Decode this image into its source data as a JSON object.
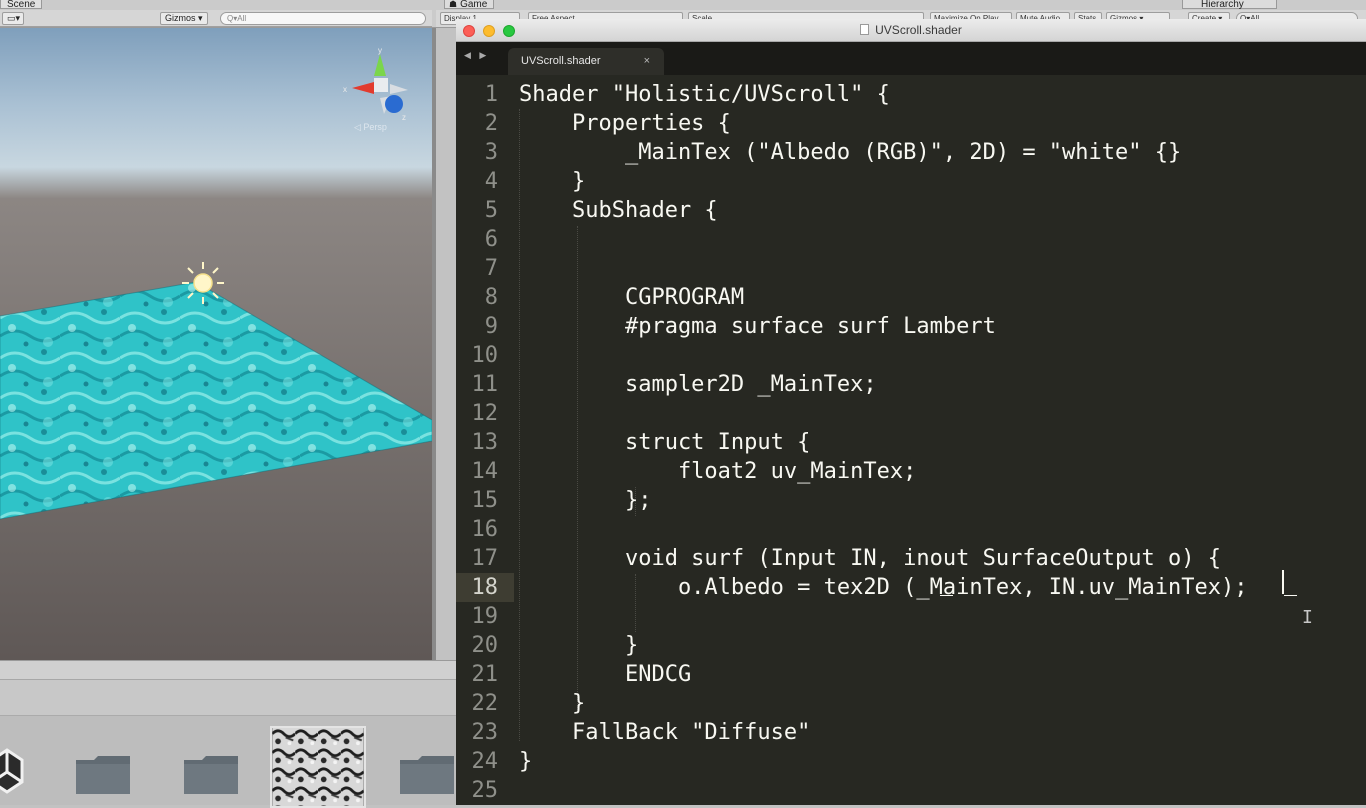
{
  "unity": {
    "scene_tab": "Scene",
    "game_tab": "Game",
    "hierarchy_tab": "Hierarchy",
    "gizmos_label": "Gizmos ▾",
    "search_placeholder": "Q▾All",
    "game_toolbar": {
      "display": "Display 1",
      "aspect": "Free Aspect",
      "scale": "Scale",
      "maximize": "Maximize On Play",
      "mute": "Mute Audio",
      "stats": "Stats",
      "gizmos": "Gizmos ▾",
      "create": "Create ▾"
    },
    "axis_labels": {
      "y": "y",
      "x": "x",
      "z": "z"
    },
    "view_label": "◁ Persp"
  },
  "editor": {
    "window_title": "UVScroll.shader",
    "tab_label": "UVScroll.shader",
    "tab_close": "×",
    "nav_arrows": "◀ ▶",
    "active_line": 18,
    "lines": [
      {
        "n": "1",
        "text": "Shader \"Holistic/UVScroll\" {"
      },
      {
        "n": "2",
        "text": "    Properties {"
      },
      {
        "n": "3",
        "text": "        _MainTex (\"Albedo (RGB)\", 2D) = \"white\" {}"
      },
      {
        "n": "4",
        "text": "    }"
      },
      {
        "n": "5",
        "text": "    SubShader {"
      },
      {
        "n": "6",
        "text": ""
      },
      {
        "n": "7",
        "text": ""
      },
      {
        "n": "8",
        "text": "        CGPROGRAM"
      },
      {
        "n": "9",
        "text": "        #pragma surface surf Lambert"
      },
      {
        "n": "10",
        "text": ""
      },
      {
        "n": "11",
        "text": "        sampler2D _MainTex;"
      },
      {
        "n": "12",
        "text": ""
      },
      {
        "n": "13",
        "text": "        struct Input {"
      },
      {
        "n": "14",
        "text": "            float2 uv_MainTex;"
      },
      {
        "n": "15",
        "text": "        };"
      },
      {
        "n": "16",
        "text": ""
      },
      {
        "n": "17",
        "text": "        void surf (Input IN, inout SurfaceOutput o) {"
      },
      {
        "n": "18",
        "text": "            o.Albedo = tex2D (_MainTex, IN.uv_MainTex);"
      },
      {
        "n": "19",
        "text": ""
      },
      {
        "n": "20",
        "text": "        }"
      },
      {
        "n": "21",
        "text": "        ENDCG"
      },
      {
        "n": "22",
        "text": "    }"
      },
      {
        "n": "23",
        "text": "    FallBack \"Diffuse\""
      },
      {
        "n": "24",
        "text": "}"
      },
      {
        "n": "25",
        "text": ""
      }
    ]
  },
  "colors": {
    "editor_bg": "#272822",
    "text": "#f8f8f2",
    "line_numbers": "#8f908a",
    "active_gutter": "#3e3d32"
  }
}
